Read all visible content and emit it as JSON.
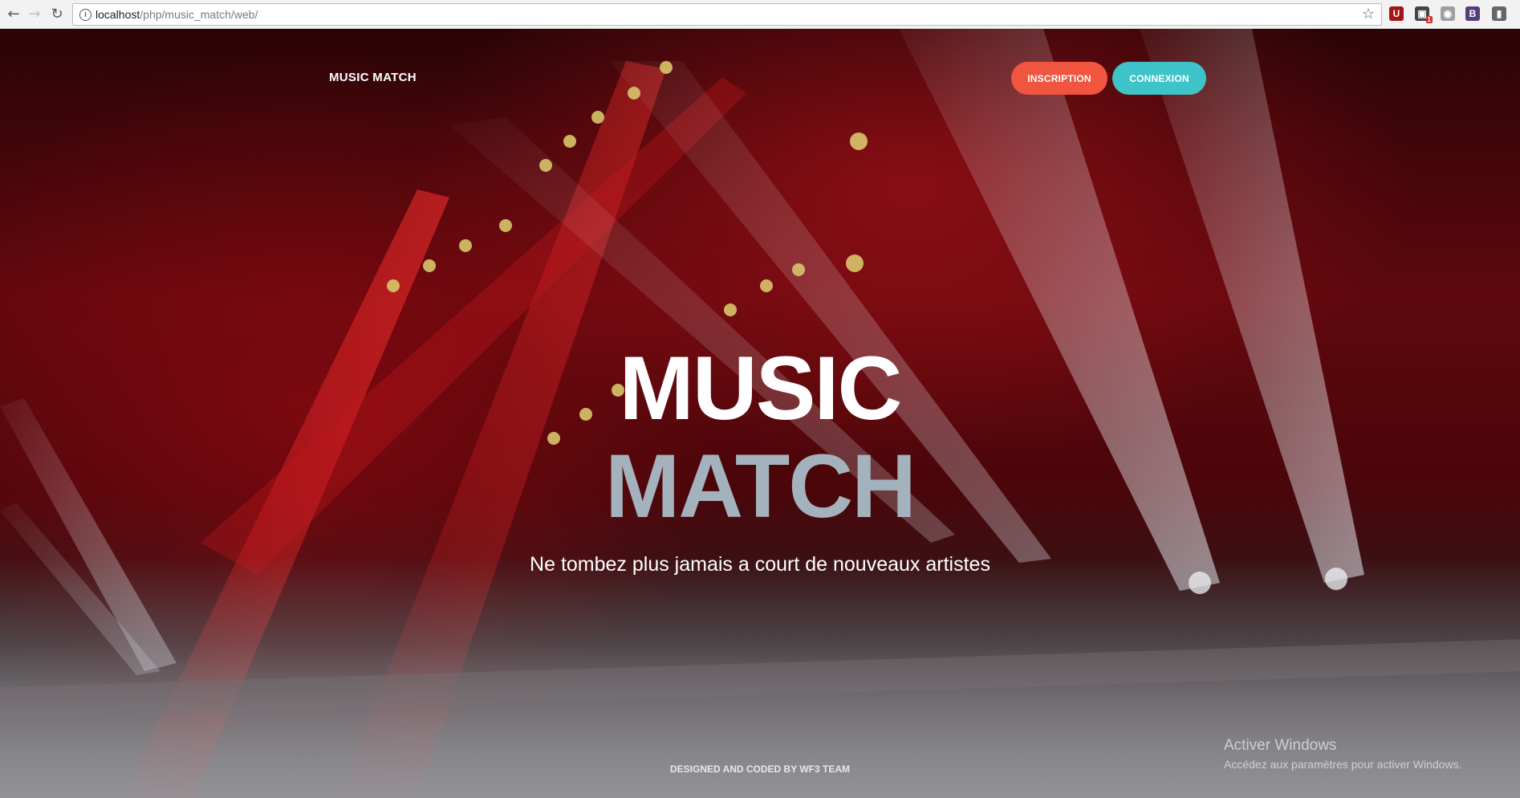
{
  "browser": {
    "back_icon": "←",
    "forward_icon": "→",
    "reload_icon": "↻",
    "url_host": "localhost",
    "url_path": "/php/music_match/web/",
    "star_icon": "☆",
    "extensions": [
      {
        "name": "ublock-icon",
        "glyph": "U",
        "color": "#a31515"
      },
      {
        "name": "extension-icon",
        "glyph": "▣",
        "color": "#444444",
        "badge": "1"
      },
      {
        "name": "spy-icon",
        "glyph": "◉",
        "color": "#9e9e9e"
      },
      {
        "name": "bootstrap-icon",
        "glyph": "B",
        "color": "#563d7c"
      },
      {
        "name": "menu-icon",
        "glyph": "▮",
        "color": "#666666"
      }
    ]
  },
  "header": {
    "brand": "MUSIC MATCH",
    "inscription_label": "INSCRIPTION",
    "connexion_label": "CONNEXION"
  },
  "hero": {
    "title_line1": "MUSIC",
    "title_line2": "MATCH",
    "tagline": "Ne tombez plus jamais a court de nouveaux artistes"
  },
  "footer": {
    "credit": "DESIGNED AND CODED BY WF3 TEAM"
  },
  "watermark": {
    "title": "Activer Windows",
    "subtitle": "Accédez aux paramètres pour activer Windows."
  },
  "colors": {
    "inscription": "#f2553f",
    "connexion": "#3ec4c8",
    "title_secondary": "#a3b2bc"
  }
}
